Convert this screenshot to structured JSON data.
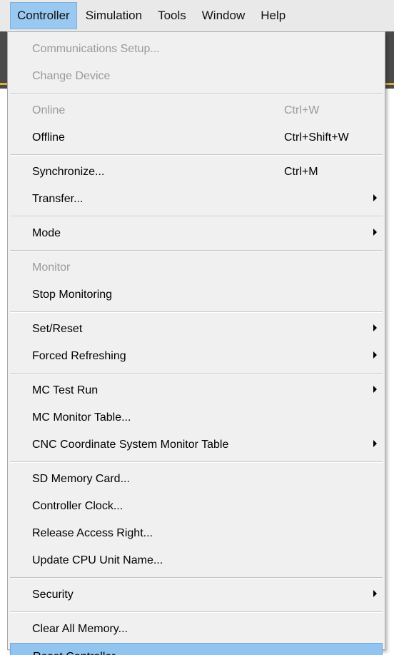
{
  "menubar": {
    "items": [
      "Controller",
      "Simulation",
      "Tools",
      "Window",
      "Help"
    ],
    "active_index": 0
  },
  "menu": {
    "groups": [
      [
        {
          "label": "Communications Setup...",
          "disabled": true
        },
        {
          "label": "Change Device",
          "disabled": true
        }
      ],
      [
        {
          "label": "Online",
          "shortcut": "Ctrl+W",
          "disabled": true
        },
        {
          "label": "Offline",
          "shortcut": "Ctrl+Shift+W"
        }
      ],
      [
        {
          "label": "Synchronize...",
          "shortcut": "Ctrl+M"
        },
        {
          "label": "Transfer...",
          "submenu": true
        }
      ],
      [
        {
          "label": "Mode",
          "submenu": true
        }
      ],
      [
        {
          "label": "Monitor",
          "disabled": true
        },
        {
          "label": "Stop Monitoring"
        }
      ],
      [
        {
          "label": "Set/Reset",
          "submenu": true
        },
        {
          "label": "Forced Refreshing",
          "submenu": true
        }
      ],
      [
        {
          "label": "MC Test Run",
          "submenu": true
        },
        {
          "label": "MC Monitor Table..."
        },
        {
          "label": "CNC Coordinate System Monitor Table",
          "submenu": true
        }
      ],
      [
        {
          "label": "SD Memory Card..."
        },
        {
          "label": "Controller Clock..."
        },
        {
          "label": "Release Access Right..."
        },
        {
          "label": "Update CPU Unit Name..."
        }
      ],
      [
        {
          "label": "Security",
          "submenu": true
        }
      ],
      [
        {
          "label": "Clear All Memory..."
        },
        {
          "label": "Reset Controller...",
          "highlighted": true
        }
      ]
    ]
  },
  "colors": {
    "highlight": "#91c4ef",
    "disabled_text": "#9a9a9a",
    "menu_bg": "#f0f0f0"
  }
}
